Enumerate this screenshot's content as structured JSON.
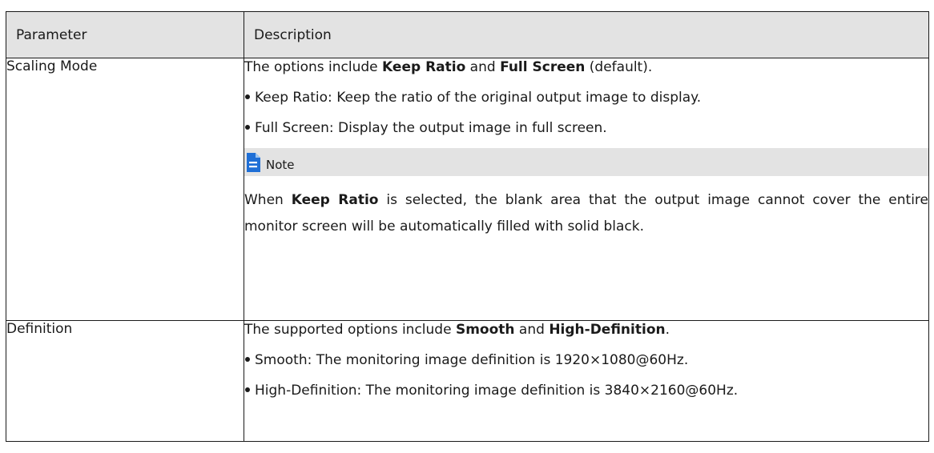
{
  "table": {
    "headers": [
      "Parameter",
      "Description"
    ],
    "rows": [
      {
        "parameter": "Scaling Mode",
        "intro": {
          "pre": "The options include ",
          "opt1": "Keep Ratio",
          "mid": " and ",
          "opt2": "Full Screen",
          "post": " (default)."
        },
        "bullets": [
          "Keep Ratio: Keep the ratio of the original output image to display.",
          "Full Screen: Display the output image in full screen."
        ],
        "note": {
          "icon": "note-icon",
          "label": "Note",
          "pre": "When ",
          "bold": "Keep Ratio",
          "post": " is selected, the blank area that the output image cannot cover the entire monitor screen will be automatically filled with solid black."
        }
      },
      {
        "parameter": "Definition",
        "intro": {
          "pre": "The supported options include ",
          "opt1": "Smooth",
          "mid": " and ",
          "opt2": "High-Definition",
          "post": "."
        },
        "bullets": [
          "Smooth: The monitoring image definition is 1920×1080@60Hz.",
          "High-Definition: The monitoring image definition is 3840×2160@60Hz."
        ]
      }
    ]
  },
  "colors": {
    "header_bg": "#e3e3e3",
    "note_icon": "#1f6fd6",
    "border": "#1a1a1a"
  }
}
